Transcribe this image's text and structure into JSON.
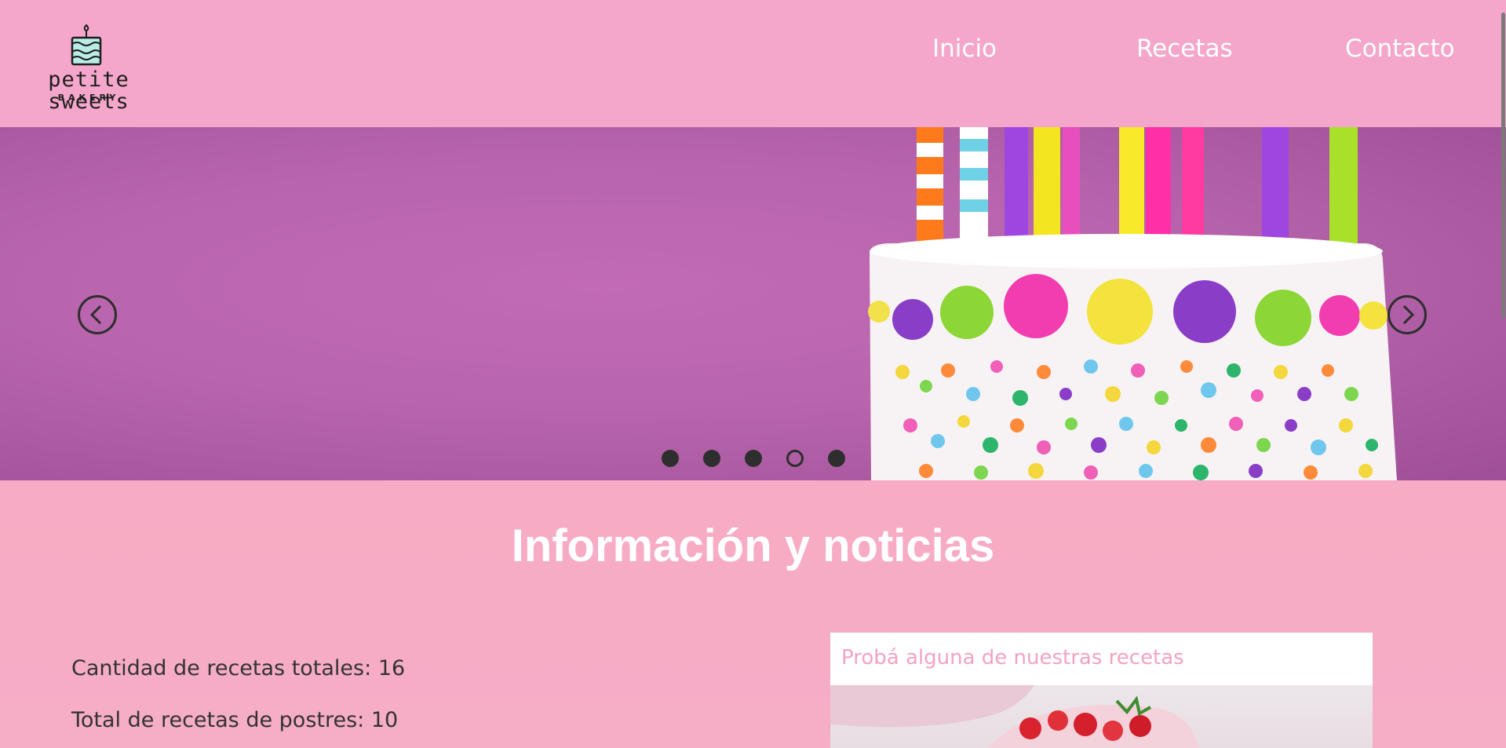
{
  "brand": {
    "name": "petite sweets",
    "subtitle": "BAKERY",
    "icon": "cake-icon"
  },
  "nav": {
    "items": [
      {
        "label": "Inicio"
      },
      {
        "label": "Recetas"
      },
      {
        "label": "Contacto"
      }
    ]
  },
  "carousel": {
    "image": "birthday-cake-with-candles-and-sprinkles",
    "prev_icon": "chevron-left-icon",
    "next_icon": "chevron-right-icon",
    "slide_count": 5,
    "active_index": 3
  },
  "info": {
    "title": "Información y noticias",
    "stats": [
      {
        "label": "Cantidad de recetas totales:",
        "value": "16"
      },
      {
        "label": "Total de recetas de postres:",
        "value": "10"
      }
    ],
    "card": {
      "title": "Probá alguna de nuestras recetas",
      "image": "strawberry-dessert-photo"
    }
  },
  "colors": {
    "header_bg": "#f4a7cb",
    "hero_bg": "#b865ad",
    "accent_pink": "#f2a3c3",
    "text_dark": "#333333"
  }
}
